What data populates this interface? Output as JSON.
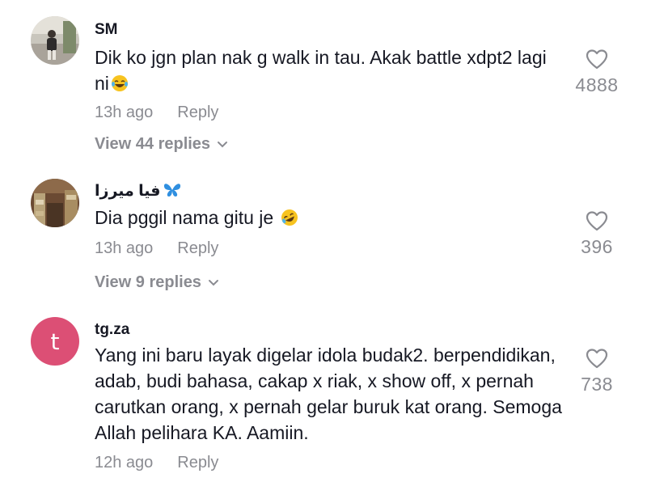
{
  "comments": [
    {
      "username": "SM",
      "text": "Dik ko jgn plan nak g walk in tau. Akak battle xdpt2 lagi ni",
      "emoji": "laughing-tears-emoji",
      "time": "13h ago",
      "reply_label": "Reply",
      "view_replies": "View 44 replies",
      "likes": "4888"
    },
    {
      "username": "فيا ميرزا",
      "username_icon": "butterfly-emoji",
      "text": "Dia pggil nama gitu je",
      "emoji": "rolling-laughing-emoji",
      "time": "13h ago",
      "reply_label": "Reply",
      "view_replies": "View 9 replies",
      "likes": "396"
    },
    {
      "username": "tg.za",
      "avatar_letter": "t",
      "avatar_color": "#dc4f75",
      "text": "Yang ini baru layak digelar idola budak2. berpendidikan, adab, budi bahasa, cakap x riak, x show off, x pernah carutkan orang, x pernah gelar buruk kat orang. Semoga Allah pelihara KA. Aamiin.",
      "time": "12h ago",
      "reply_label": "Reply",
      "likes": "738"
    }
  ]
}
